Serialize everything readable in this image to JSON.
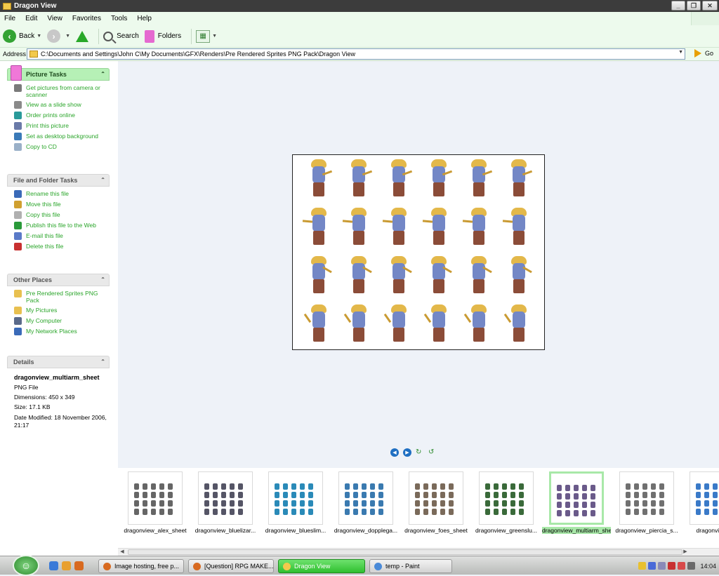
{
  "window": {
    "title": "Dragon View",
    "controls": [
      "minimize",
      "maximize",
      "close"
    ]
  },
  "menu": [
    "File",
    "Edit",
    "View",
    "Favorites",
    "Tools",
    "Help"
  ],
  "toolbar": {
    "back_label": "Back",
    "search_label": "Search",
    "folders_label": "Folders"
  },
  "address": {
    "label": "Address",
    "path": "C:\\Documents and Settings\\John C\\My Documents\\GFX\\Renders\\Pre Rendered Sprites PNG Pack\\Dragon View",
    "go_label": "Go"
  },
  "picture_tasks": {
    "title": "Picture Tasks",
    "items": [
      {
        "label": "Get pictures from camera or scanner",
        "icon": "camera-icon",
        "color": "#7a7a7a"
      },
      {
        "label": "View as a slide show",
        "icon": "slideshow-icon",
        "color": "#8a8a8a"
      },
      {
        "label": "Order prints online",
        "icon": "globe-icon",
        "color": "#2a9a9a"
      },
      {
        "label": "Print this picture",
        "icon": "printer-icon",
        "color": "#6a7aa8"
      },
      {
        "label": "Set as desktop background",
        "icon": "desktop-icon",
        "color": "#3a7ab8"
      },
      {
        "label": "Copy to CD",
        "icon": "cd-icon",
        "color": "#9ab0c8"
      }
    ]
  },
  "file_tasks": {
    "title": "File and Folder Tasks",
    "items": [
      {
        "label": "Rename this file",
        "icon": "rename-icon",
        "color": "#3a6ab8"
      },
      {
        "label": "Move this file",
        "icon": "move-icon",
        "color": "#d0a030"
      },
      {
        "label": "Copy this file",
        "icon": "copy-icon",
        "color": "#b0b0b0"
      },
      {
        "label": "Publish this file to the Web",
        "icon": "web-icon",
        "color": "#2a9a3a"
      },
      {
        "label": "E-mail this file",
        "icon": "email-icon",
        "color": "#5a7ac8"
      },
      {
        "label": "Delete this file",
        "icon": "delete-icon",
        "color": "#c83030"
      }
    ]
  },
  "other_places": {
    "title": "Other Places",
    "items": [
      {
        "label": "Pre Rendered Sprites PNG Pack",
        "icon": "folder-icon",
        "color": "#e8c050"
      },
      {
        "label": "My Pictures",
        "icon": "folder-icon",
        "color": "#e8c050"
      },
      {
        "label": "My Computer",
        "icon": "computer-icon",
        "color": "#5a6a8a"
      },
      {
        "label": "My Network Places",
        "icon": "network-icon",
        "color": "#3a6ab8"
      }
    ]
  },
  "details": {
    "title": "Details",
    "name": "dragonview_multiarm_sheet",
    "type": "PNG File",
    "dimensions": "Dimensions: 450 x 349",
    "size": "Size: 17.1 KB",
    "date_modified": "Date Modified: 18 November 2006, 21:17"
  },
  "filmstrip": [
    {
      "label": "dragonview_alex_sheet",
      "color": "#666666",
      "selected": false
    },
    {
      "label": "dragonview_bluelizar...",
      "color": "#555566",
      "selected": false
    },
    {
      "label": "dragonview_blueslim...",
      "color": "#2a8ab8",
      "selected": false
    },
    {
      "label": "dragonview_dopplega...",
      "color": "#3a7ab0",
      "selected": false
    },
    {
      "label": "dragonview_foes_sheet",
      "color": "#7a6a5a",
      "selected": false
    },
    {
      "label": "dragonview_greenslu...",
      "color": "#3a6a3a",
      "selected": false
    },
    {
      "label": "dragonview_multiarm_sheet",
      "color": "#6a5a8a",
      "selected": true
    },
    {
      "label": "dragonview_piercia_s...",
      "color": "#707070",
      "selected": false
    },
    {
      "label": "dragonview_v...",
      "color": "#3a7ac8",
      "selected": false
    }
  ],
  "taskbar": {
    "start": "start",
    "tasks": [
      {
        "label": "Image hosting, free p...",
        "icon_color": "#d86a20",
        "active": false
      },
      {
        "label": "[Question] RPG MAKE...",
        "icon_color": "#d86a20",
        "active": false
      },
      {
        "label": "Dragon View",
        "icon_color": "#f2c94c",
        "active": true
      },
      {
        "label": "temp - Paint",
        "icon_color": "#4a8ad8",
        "active": false
      }
    ],
    "clock": "14:04"
  }
}
